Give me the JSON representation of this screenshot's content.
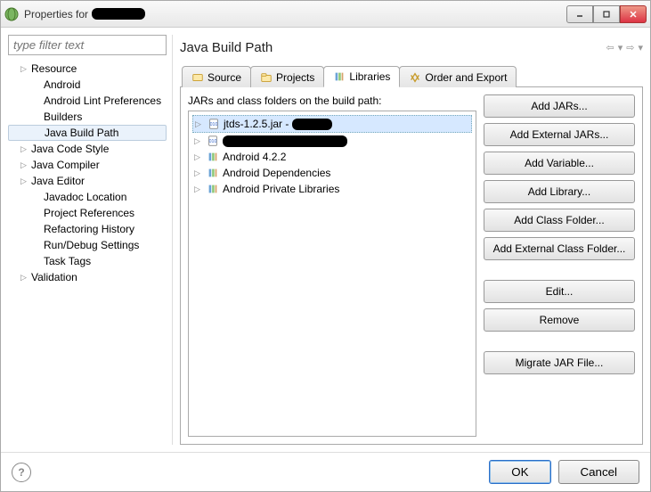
{
  "window": {
    "title_prefix": "Properties for"
  },
  "filter": {
    "placeholder": "type filter text"
  },
  "sidebar": {
    "items": [
      {
        "label": "Resource",
        "level": 1,
        "expandable": true
      },
      {
        "label": "Android",
        "level": 2,
        "expandable": false
      },
      {
        "label": "Android Lint Preferences",
        "level": 2,
        "expandable": false
      },
      {
        "label": "Builders",
        "level": 2,
        "expandable": false
      },
      {
        "label": "Java Build Path",
        "level": 2,
        "expandable": false,
        "selected": true
      },
      {
        "label": "Java Code Style",
        "level": 1,
        "expandable": true
      },
      {
        "label": "Java Compiler",
        "level": 1,
        "expandable": true
      },
      {
        "label": "Java Editor",
        "level": 1,
        "expandable": true
      },
      {
        "label": "Javadoc Location",
        "level": 2,
        "expandable": false
      },
      {
        "label": "Project References",
        "level": 2,
        "expandable": false
      },
      {
        "label": "Refactoring History",
        "level": 2,
        "expandable": false
      },
      {
        "label": "Run/Debug Settings",
        "level": 2,
        "expandable": false
      },
      {
        "label": "Task Tags",
        "level": 2,
        "expandable": false
      },
      {
        "label": "Validation",
        "level": 1,
        "expandable": true
      }
    ]
  },
  "main": {
    "title": "Java Build Path"
  },
  "tabs": [
    {
      "label": "Source",
      "icon": "source-icon"
    },
    {
      "label": "Projects",
      "icon": "projects-icon"
    },
    {
      "label": "Libraries",
      "icon": "libraries-icon",
      "active": true
    },
    {
      "label": "Order and Export",
      "icon": "order-icon"
    }
  ],
  "libraries": {
    "heading": "JARs and class folders on the build path:",
    "rows": [
      {
        "label_prefix": "jtds-1.2.5.jar - ",
        "redacted_suffix": true,
        "type": "jar",
        "selected": true
      },
      {
        "redacted_full": true,
        "type": "jar"
      },
      {
        "label": "Android 4.2.2",
        "type": "lib"
      },
      {
        "label": "Android Dependencies",
        "type": "lib"
      },
      {
        "label": "Android Private Libraries",
        "type": "lib"
      }
    ]
  },
  "buttons": {
    "add_jars": "Add JARs...",
    "add_external_jars": "Add External JARs...",
    "add_variable": "Add Variable...",
    "add_library": "Add Library...",
    "add_class_folder": "Add Class Folder...",
    "add_external_class_folder": "Add External Class Folder...",
    "edit": "Edit...",
    "remove": "Remove",
    "migrate": "Migrate JAR File..."
  },
  "footer": {
    "ok": "OK",
    "cancel": "Cancel"
  }
}
